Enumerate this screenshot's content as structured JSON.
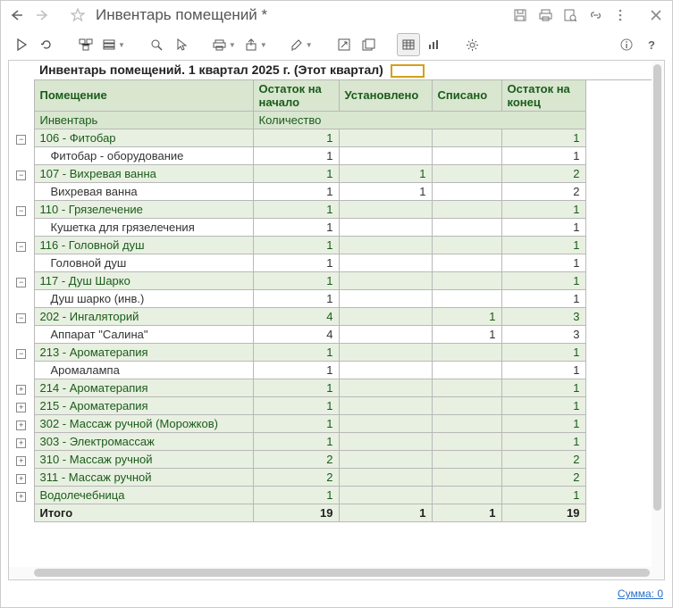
{
  "titlebar": {
    "title": "Инвентарь помещений *"
  },
  "report": {
    "title": "Инвентарь помещений. 1 квартал 2025 г. (Этот квартал)",
    "columns": {
      "room": "Помещение",
      "start": "Остаток на начало",
      "installed": "Установлено",
      "disposed": "Списано",
      "end": "Остаток на конец"
    },
    "subheader": {
      "inventory": "Инвентарь",
      "quantity": "Количество"
    },
    "rows": [
      {
        "type": "group",
        "expand": "minus",
        "label": "106 - Фитобар",
        "start": 1,
        "installed": "",
        "disposed": "",
        "end": 1
      },
      {
        "type": "detail",
        "label": "Фитобар - оборудование",
        "start": 1,
        "installed": "",
        "disposed": "",
        "end": 1
      },
      {
        "type": "group",
        "expand": "minus",
        "label": "107 - Вихревая ванна",
        "start": 1,
        "installed": 1,
        "disposed": "",
        "end": 2
      },
      {
        "type": "detail",
        "label": "Вихревая ванна",
        "start": 1,
        "installed": 1,
        "disposed": "",
        "end": 2
      },
      {
        "type": "group",
        "expand": "minus",
        "label": "110 - Грязелечение",
        "start": 1,
        "installed": "",
        "disposed": "",
        "end": 1
      },
      {
        "type": "detail",
        "label": "Кушетка для грязелечения",
        "start": 1,
        "installed": "",
        "disposed": "",
        "end": 1
      },
      {
        "type": "group",
        "expand": "minus",
        "label": "116 - Головной душ",
        "start": 1,
        "installed": "",
        "disposed": "",
        "end": 1
      },
      {
        "type": "detail",
        "label": "Головной душ",
        "start": 1,
        "installed": "",
        "disposed": "",
        "end": 1
      },
      {
        "type": "group",
        "expand": "minus",
        "label": "117 - Душ Шарко",
        "start": 1,
        "installed": "",
        "disposed": "",
        "end": 1
      },
      {
        "type": "detail",
        "label": "Душ шарко (инв.)",
        "start": 1,
        "installed": "",
        "disposed": "",
        "end": 1
      },
      {
        "type": "group",
        "expand": "minus",
        "label": "202 - Ингаляторий",
        "start": 4,
        "installed": "",
        "disposed": 1,
        "end": 3
      },
      {
        "type": "detail",
        "label": "Аппарат \"Салина\"",
        "start": 4,
        "installed": "",
        "disposed": 1,
        "end": 3
      },
      {
        "type": "group",
        "expand": "minus",
        "label": "213 - Ароматерапия",
        "start": 1,
        "installed": "",
        "disposed": "",
        "end": 1
      },
      {
        "type": "detail",
        "label": "Аромалампа",
        "start": 1,
        "installed": "",
        "disposed": "",
        "end": 1
      },
      {
        "type": "group",
        "expand": "plus",
        "label": "214 - Ароматерапия",
        "start": 1,
        "installed": "",
        "disposed": "",
        "end": 1
      },
      {
        "type": "group",
        "expand": "plus",
        "label": "215 - Ароматерапия",
        "start": 1,
        "installed": "",
        "disposed": "",
        "end": 1
      },
      {
        "type": "group",
        "expand": "plus",
        "label": "302 - Массаж ручной (Морожков)",
        "start": 1,
        "installed": "",
        "disposed": "",
        "end": 1
      },
      {
        "type": "group",
        "expand": "plus",
        "label": "303 - Электромассаж",
        "start": 1,
        "installed": "",
        "disposed": "",
        "end": 1
      },
      {
        "type": "group",
        "expand": "plus",
        "label": "310 - Массаж ручной",
        "start": 2,
        "installed": "",
        "disposed": "",
        "end": 2
      },
      {
        "type": "group",
        "expand": "plus",
        "label": "311 - Массаж ручной",
        "start": 2,
        "installed": "",
        "disposed": "",
        "end": 2
      },
      {
        "type": "group",
        "expand": "plus",
        "label": "Водолечебница",
        "start": 1,
        "installed": "",
        "disposed": "",
        "end": 1
      }
    ],
    "total": {
      "label": "Итого",
      "start": 19,
      "installed": 1,
      "disposed": 1,
      "end": 19
    }
  },
  "status": {
    "sum_label": "Сумма:",
    "sum_value": "0"
  },
  "icons": {
    "back": "back-icon",
    "forward": "forward-icon",
    "star": "star-icon",
    "save": "save-icon",
    "print": "print-icon",
    "preview": "preview-icon",
    "link": "link-icon",
    "more": "more-icon",
    "close": "close-icon",
    "run": "run-icon",
    "refresh": "refresh-icon",
    "structure": "structure-icon",
    "variants": "variants-icon",
    "find": "find-icon",
    "cursor": "cursor-icon",
    "printer": "printer-icon",
    "export": "export-icon",
    "edit": "edit-icon",
    "openedit": "openedit-icon",
    "newwin": "newwin-icon",
    "table": "table-icon",
    "chart": "chart-icon",
    "settings": "settings-icon",
    "info": "info-icon",
    "help": "help-icon"
  }
}
